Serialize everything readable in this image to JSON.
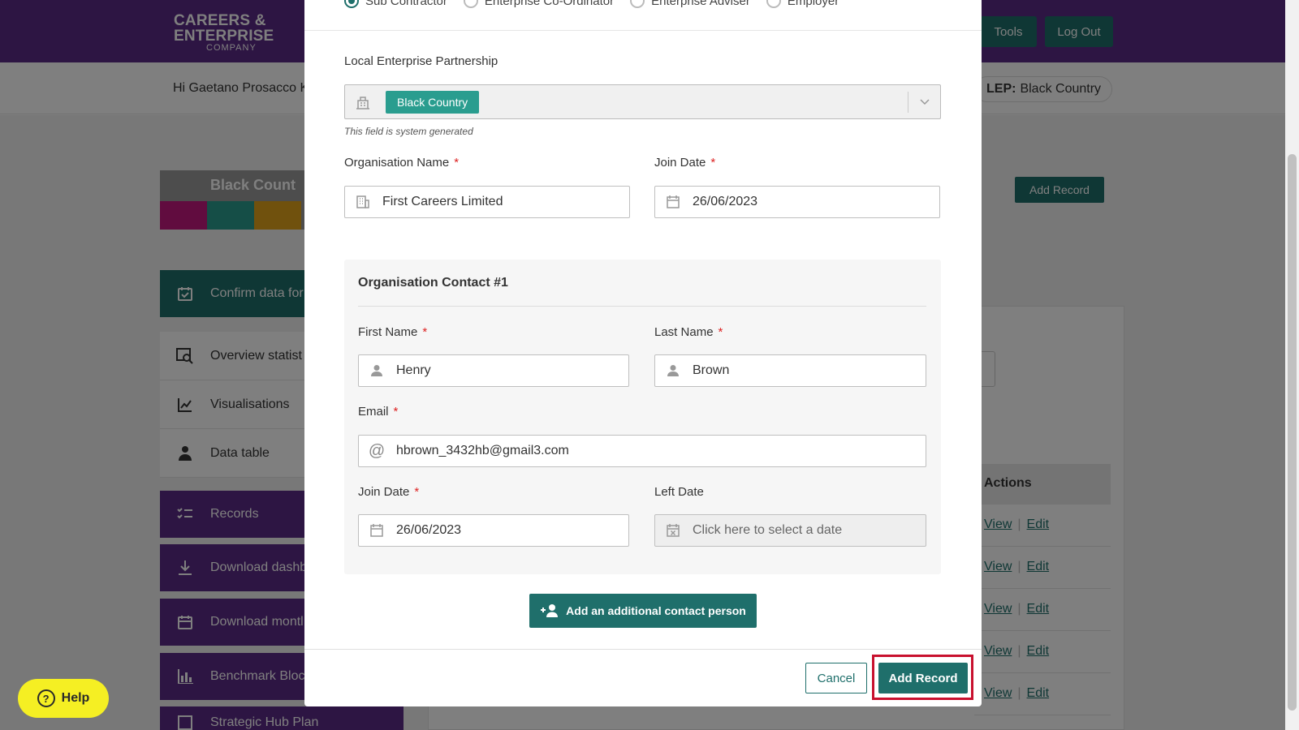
{
  "header": {
    "logo_line1": "CAREERS &",
    "logo_line2": "ENTERPRISE",
    "logo_line3": "COMPANY",
    "tools_label": "Tools",
    "logout_label": "Log Out",
    "greeting": "Hi Gaetano Prosacco K",
    "lep_label": "LEP:",
    "lep_value": "Black Country"
  },
  "region_card": {
    "title": "Black Count",
    "strip_colors": [
      "#c2187f",
      "#2a9d8f",
      "#e0a21a",
      "#9a9a9a",
      "#9a9a9a"
    ]
  },
  "sidebar": {
    "confirm": "Confirm data for",
    "overview": "Overview statist",
    "visualisations": "Visualisations",
    "data_table": "Data table",
    "records": "Records",
    "download_dash": "Download dashb",
    "download_month": "Download montl",
    "benchmark": "Benchmark Bloc",
    "strategic": "Strategic Hub Plan"
  },
  "background": {
    "add_record_label": "Add Record",
    "actions_header": "Actions",
    "row_view": "View",
    "row_edit": "Edit"
  },
  "help": {
    "label": "Help"
  },
  "modal": {
    "radio_options": [
      "Sub Contractor",
      "Enterprise Co-Ordinator",
      "Enterprise Adviser",
      "Employer"
    ],
    "lep_section_label": "Local Enterprise Partnership",
    "lep_tag": "Black Country",
    "lep_helper": "This field is system generated",
    "org_name_label": "Organisation Name",
    "org_name_value": "First Careers Limited",
    "join_date_label": "Join Date",
    "join_date_value": "26/06/2023",
    "required_mark": "*",
    "contact": {
      "title": "Organisation Contact #1",
      "first_name_label": "First Name",
      "first_name_value": "Henry",
      "last_name_label": "Last Name",
      "last_name_value": "Brown",
      "email_label": "Email",
      "email_value": "hbrown_3432hb@gmail3.com",
      "join_date_label": "Join Date",
      "join_date_value": "26/06/2023",
      "left_date_label": "Left Date",
      "left_date_placeholder": "Click here to select a date"
    },
    "add_contact_label": "Add an additional contact person",
    "cancel_label": "Cancel",
    "add_record_label": "Add Record"
  }
}
